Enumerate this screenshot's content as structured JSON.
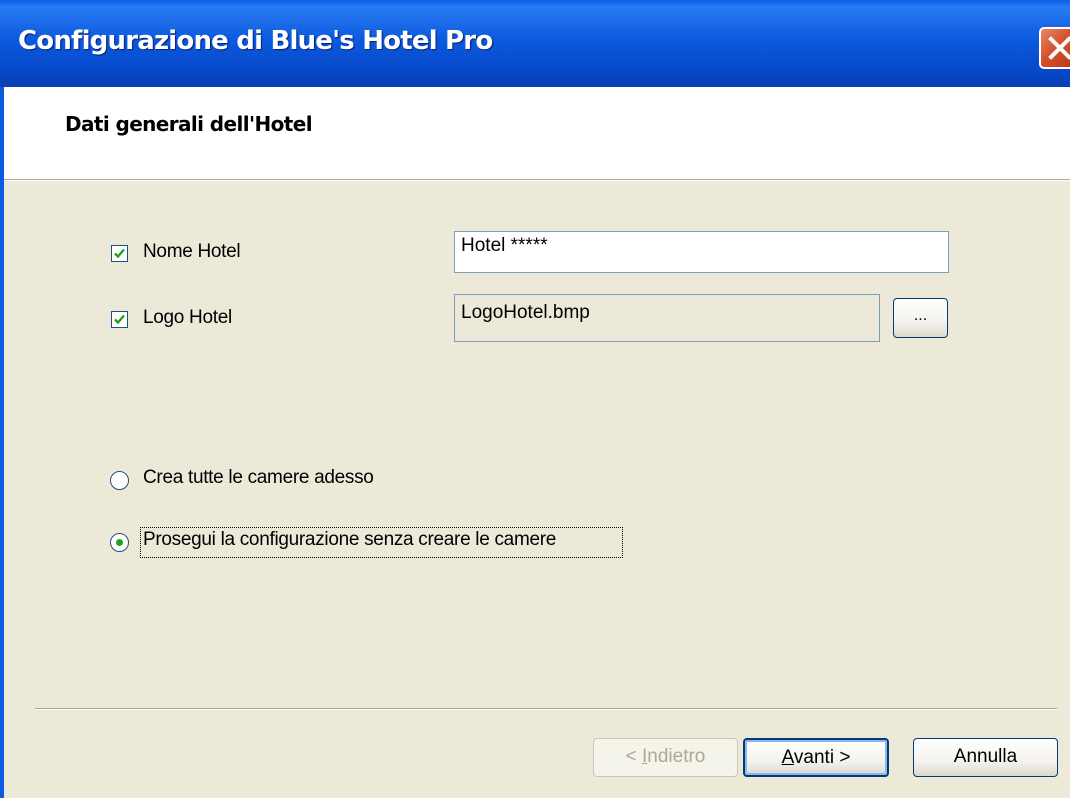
{
  "window": {
    "title": "Configurazione di Blue's Hotel Pro",
    "close_label": "Close"
  },
  "header": {
    "title": "Dati generali dell'Hotel"
  },
  "fields": {
    "nome_hotel": {
      "label": "Nome Hotel",
      "checked": true,
      "value": "Hotel *****"
    },
    "logo_hotel": {
      "label": "Logo Hotel",
      "checked": true,
      "value": "LogoHotel.bmp",
      "browse_label": "..."
    }
  },
  "options": {
    "crea": {
      "label": "Crea tutte le camere adesso",
      "selected": false
    },
    "prosegui": {
      "label": "Prosegui la configurazione senza creare le camere",
      "selected": true
    }
  },
  "buttons": {
    "back": {
      "prefix": "< ",
      "hotkey": "I",
      "rest": "ndietro",
      "enabled": false
    },
    "next": {
      "hotkey": "A",
      "rest": "vanti >"
    },
    "cancel": {
      "label": "Annulla"
    }
  },
  "colors": {
    "titlebar": "#0B5AE0",
    "face": "#ECE9D8",
    "close": "#D4502B"
  }
}
